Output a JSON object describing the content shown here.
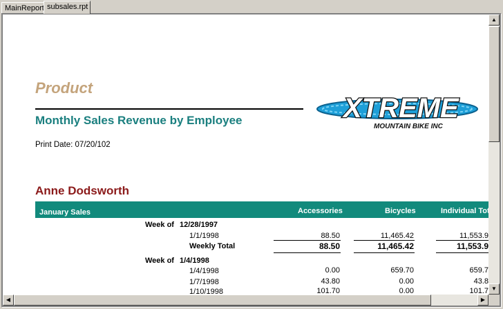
{
  "tabs": [
    {
      "label": "MainReport"
    },
    {
      "label": "subsales.rpt"
    }
  ],
  "report": {
    "title": "Product",
    "subtitle": "Monthly Sales Revenue by Employee",
    "print_date": "Print Date: 07/20/102",
    "logo": {
      "main": "XTREME",
      "sub": "MOUNTAIN BIKE INC"
    },
    "employee": "Anne Dodsworth",
    "header": {
      "group": "January Sales",
      "col_accessories": "Accessories",
      "col_bicycles": "Bicycles",
      "col_individual": "Individual Tot"
    },
    "weeks": [
      {
        "label": "Week of",
        "date": "12/28/1997",
        "rows": [
          {
            "date": "1/1/1998",
            "accessories": "88.50",
            "bicycles": "11,465.42",
            "individual": "11,553.9"
          }
        ],
        "total": {
          "label": "Weekly Total",
          "accessories": "88.50",
          "bicycles": "11,465.42",
          "individual": "11,553.9"
        }
      },
      {
        "label": "Week of",
        "date": "1/4/1998",
        "rows": [
          {
            "date": "1/4/1998",
            "accessories": "0.00",
            "bicycles": "659.70",
            "individual": "659.7"
          },
          {
            "date": "1/7/1998",
            "accessories": "43.80",
            "bicycles": "0.00",
            "individual": "43.8"
          },
          {
            "date": "1/10/1998",
            "accessories": "101.70",
            "bicycles": "0.00",
            "individual": "101.7"
          }
        ]
      }
    ]
  },
  "colors": {
    "title": "#c4a47c",
    "subtitle": "#1a7f7f",
    "employee": "#8b1a1a",
    "band": "#128a7c"
  }
}
